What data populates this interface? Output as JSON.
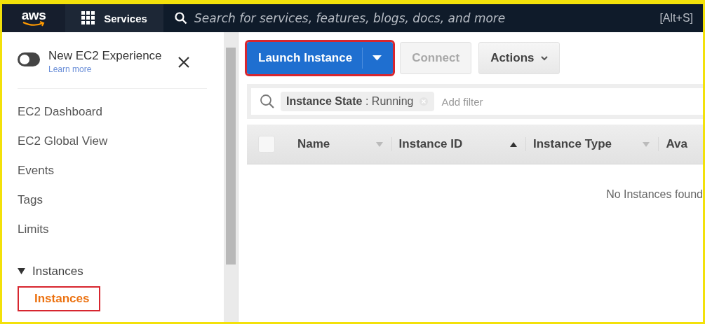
{
  "nav": {
    "logo": "aws",
    "services_label": "Services",
    "search": {
      "placeholder": "Search for services, features, blogs, docs, and more"
    },
    "shortcut": "[Alt+S]"
  },
  "sidebar": {
    "experience_toggle": {
      "label": "New EC2 Experience",
      "link": "Learn more",
      "on": false
    },
    "items": [
      {
        "label": "EC2 Dashboard",
        "selected": false
      },
      {
        "label": "EC2 Global View",
        "selected": false
      },
      {
        "label": "Events",
        "selected": false
      },
      {
        "label": "Tags",
        "selected": false
      },
      {
        "label": "Limits",
        "selected": false
      }
    ],
    "section": {
      "label": "Instances",
      "expanded": true,
      "children": [
        {
          "label": "Instances",
          "selected": true,
          "highlighted": true
        }
      ]
    }
  },
  "toolbar": {
    "buttons": [
      {
        "kind": "split",
        "label": "Launch Instance",
        "disabled": false,
        "highlighted": true
      },
      {
        "kind": "plain",
        "label": "Connect",
        "disabled": true,
        "highlighted": false
      },
      {
        "kind": "menu",
        "label": "Actions",
        "disabled": false,
        "highlighted": false
      }
    ]
  },
  "filter": {
    "tokens": [
      {
        "label": "**Instance State** : Running"
      }
    ],
    "placeholder": "Add filter"
  },
  "table": {
    "select_all": {
      "checked": false
    },
    "columns": [
      {
        "label": "Name",
        "sorted": false
      },
      {
        "label": "Instance ID",
        "sorted": true
      },
      {
        "label": "Instance Type",
        "sorted": false
      },
      {
        "label": "Ava"
      }
    ],
    "empty_message": "No Instances found"
  }
}
